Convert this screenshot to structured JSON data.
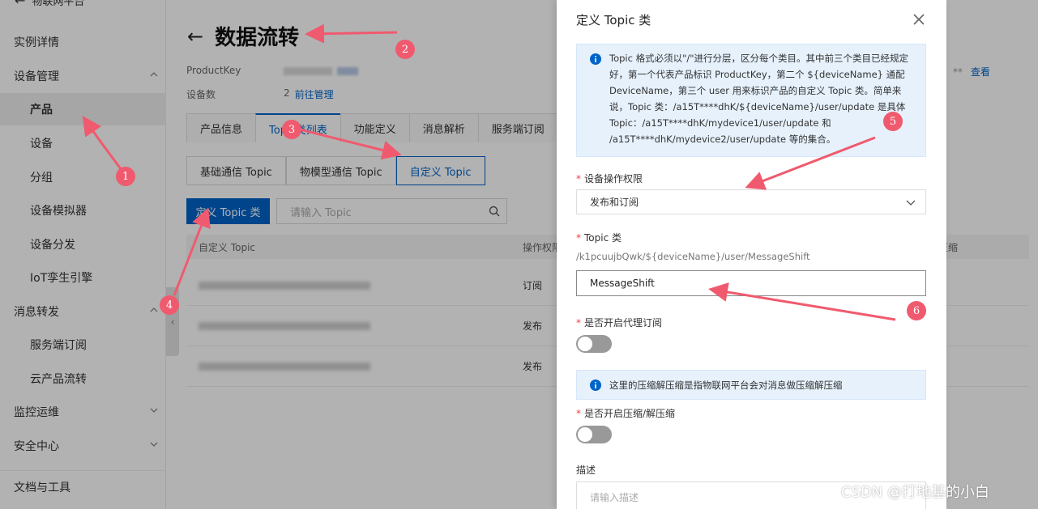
{
  "sidebar": {
    "top_label": "物联网平台",
    "items": [
      {
        "label": "实例详情",
        "level": 1
      },
      {
        "label": "设备管理",
        "level": 1,
        "expanded": true
      },
      {
        "label": "产品",
        "level": 2,
        "active": true
      },
      {
        "label": "设备",
        "level": 2
      },
      {
        "label": "分组",
        "level": 2
      },
      {
        "label": "设备模拟器",
        "level": 2
      },
      {
        "label": "设备分发",
        "level": 2
      },
      {
        "label": "IoT孪生引擎",
        "level": 2
      },
      {
        "label": "消息转发",
        "level": 1,
        "expanded": true
      },
      {
        "label": "服务端订阅",
        "level": 2
      },
      {
        "label": "云产品流转",
        "level": 2
      },
      {
        "label": "监控运维",
        "level": 1,
        "expanded": false
      },
      {
        "label": "安全中心",
        "level": 1,
        "expanded": false
      },
      {
        "label": "文档与工具",
        "level": 1
      }
    ]
  },
  "main": {
    "title": "数据流转",
    "meta": {
      "product_key_label": "ProductKey",
      "device_count_label": "设备数",
      "device_count_value": "2",
      "manage_link": "前往管理",
      "view_link": "查看",
      "masked": "**"
    },
    "tabs": [
      "产品信息",
      "Topic类列表",
      "功能定义",
      "消息解析",
      "服务端订阅"
    ],
    "active_tab": 1,
    "subtabs": [
      "基础通信 Topic",
      "物模型通信 Topic",
      "自定义 Topic"
    ],
    "active_subtab": 2,
    "define_button": "定义 Topic 类",
    "search_placeholder": "请输入 Topic",
    "table": {
      "headers": [
        "自定义 Topic",
        "操作权限",
        "压缩"
      ],
      "rows": [
        {
          "permission": "订阅"
        },
        {
          "permission": "发布"
        },
        {
          "permission": "发布"
        }
      ]
    }
  },
  "drawer": {
    "title": "定义 Topic 类",
    "info1": "Topic 格式必须以\"/\"进行分层，区分每个类目。其中前三个类目已经规定好，第一个代表产品标识 ProductKey，第二个 ${deviceName} 通配 DeviceName，第三个 user 用来标识产品的自定义 Topic 类。简单来说，Topic 类：/a15T****dhK/${deviceName}/user/update 是具体 Topic：/a15T****dhK/mydevice1/user/update 和 /a15T****dhK/mydevice2/user/update 等的集合。",
    "perm_label": "设备操作权限",
    "perm_value": "发布和订阅",
    "topic_label": "Topic 类",
    "topic_prefix": "/k1pcuujbQwk/${deviceName}/user/MessageShift",
    "topic_value": "MessageShift",
    "proxy_label": "是否开启代理订阅",
    "info2": "这里的压缩解压缩是指物联网平台会对消息做压缩解压缩",
    "compress_label": "是否开启压缩/解压缩",
    "desc_label": "描述",
    "desc_placeholder": "请输入描述"
  },
  "annotations": {
    "badges": [
      "1",
      "2",
      "3",
      "4",
      "5",
      "6"
    ],
    "color": "#f05a6e"
  },
  "watermark": "CSDN @打地基的小白"
}
